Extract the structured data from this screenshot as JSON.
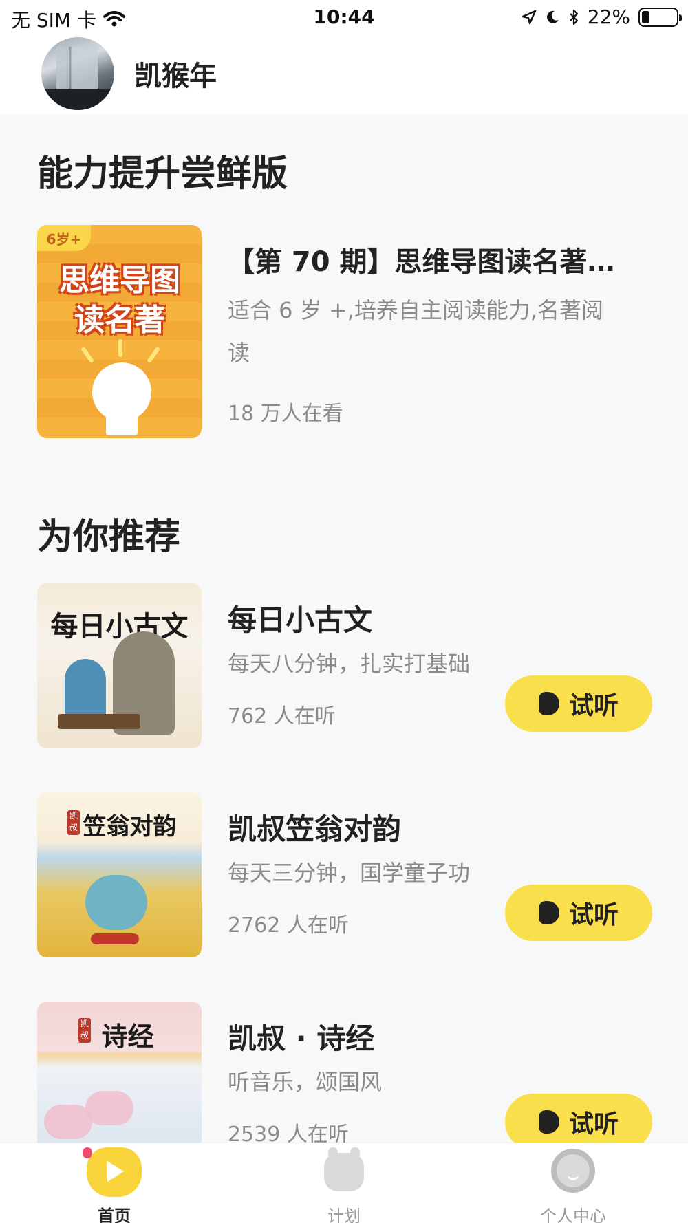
{
  "status_bar": {
    "carrier": "无 SIM 卡",
    "time": "10:44",
    "battery": "22%",
    "battery_level": 0.22
  },
  "user": {
    "name": "凯猴年"
  },
  "featured_section": {
    "title": "能力提升尝鲜版",
    "item": {
      "cover_badge": "6岁+",
      "cover_title_line1": "思维导图",
      "cover_title_line2": "读名著",
      "title": "【第 70 期】思维导图读名著…",
      "description": "适合 6 岁 +,培养自主阅读能力,名著阅读",
      "views": "18 万人在看"
    }
  },
  "recommend_section": {
    "title": "为你推荐",
    "items": [
      {
        "cover_title": "每日小古文",
        "title": "每日小古文",
        "description": "每天八分钟，扎实打基础",
        "count": "762 人在听",
        "button": "试听"
      },
      {
        "cover_title": "笠翁对韵",
        "cover_seal": "凯叔",
        "title": "凯叔笠翁对韵",
        "description": "每天三分钟，国学童子功",
        "count": "2762 人在听",
        "button": "试听"
      },
      {
        "cover_title": "诗经",
        "cover_seal": "凯叔",
        "title": "凯叔 · 诗经",
        "description": "听音乐，颂国风",
        "count": "2539 人在听",
        "button": "试听"
      }
    ]
  },
  "tab_bar": {
    "tabs": [
      {
        "label": "首页",
        "icon": "home-play-icon",
        "active": true
      },
      {
        "label": "计划",
        "icon": "plan-icon",
        "active": false
      },
      {
        "label": "个人中心",
        "icon": "headphones-face-icon",
        "active": false
      }
    ]
  },
  "colors": {
    "accent_yellow": "#f9df4b",
    "background": "#f8f8f8",
    "text_secondary": "#8a8a8a"
  }
}
